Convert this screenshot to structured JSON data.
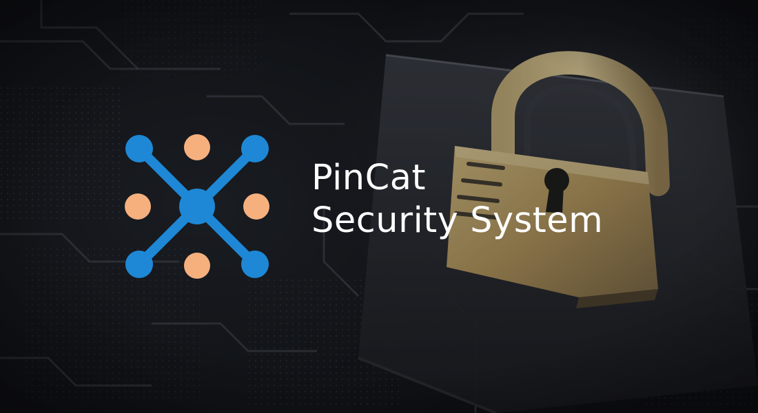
{
  "brand": {
    "line1": "PinCat",
    "line2": "Security System"
  },
  "logo": {
    "icon": "x-network-icon",
    "blue": "#1e88d6",
    "peach": "#f6b07e"
  },
  "background": {
    "icon": "padlock-icon",
    "description_color_lock": "#c9ad72"
  }
}
